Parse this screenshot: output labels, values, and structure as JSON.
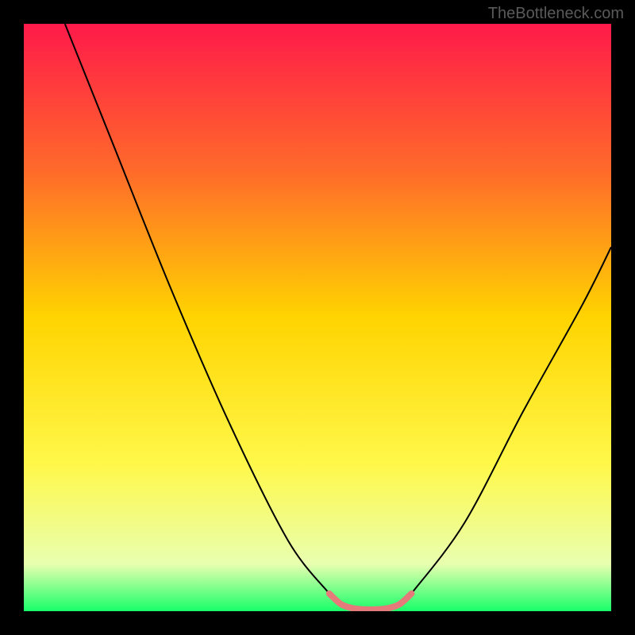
{
  "watermark": "TheBottleneck.com",
  "chart_data": {
    "type": "line",
    "title": "",
    "xlabel": "",
    "ylabel": "",
    "xlim": [
      0,
      100
    ],
    "ylim": [
      0,
      100
    ],
    "background_gradient": {
      "stops": [
        {
          "pos": 0,
          "color": "#ff1a4a"
        },
        {
          "pos": 25,
          "color": "#ff6a2a"
        },
        {
          "pos": 50,
          "color": "#ffd400"
        },
        {
          "pos": 75,
          "color": "#fff84a"
        },
        {
          "pos": 92,
          "color": "#e8ffb0"
        },
        {
          "pos": 100,
          "color": "#18ff6a"
        }
      ]
    },
    "series": [
      {
        "name": "curve-left",
        "color": "#000000",
        "width": 2,
        "x": [
          7,
          15,
          25,
          35,
          45,
          52
        ],
        "values": [
          100,
          80,
          55,
          32,
          12,
          3
        ]
      },
      {
        "name": "curve-right",
        "color": "#000000",
        "width": 2,
        "x": [
          66,
          75,
          85,
          95,
          100
        ],
        "values": [
          3,
          15,
          34,
          52,
          62
        ]
      },
      {
        "name": "bottom-highlight",
        "color": "#e47a7a",
        "width": 8,
        "linecap": "round",
        "x": [
          52,
          54,
          56,
          58,
          60,
          62,
          64,
          66
        ],
        "values": [
          3,
          1.2,
          0.5,
          0.3,
          0.3,
          0.5,
          1.2,
          3
        ]
      }
    ]
  }
}
